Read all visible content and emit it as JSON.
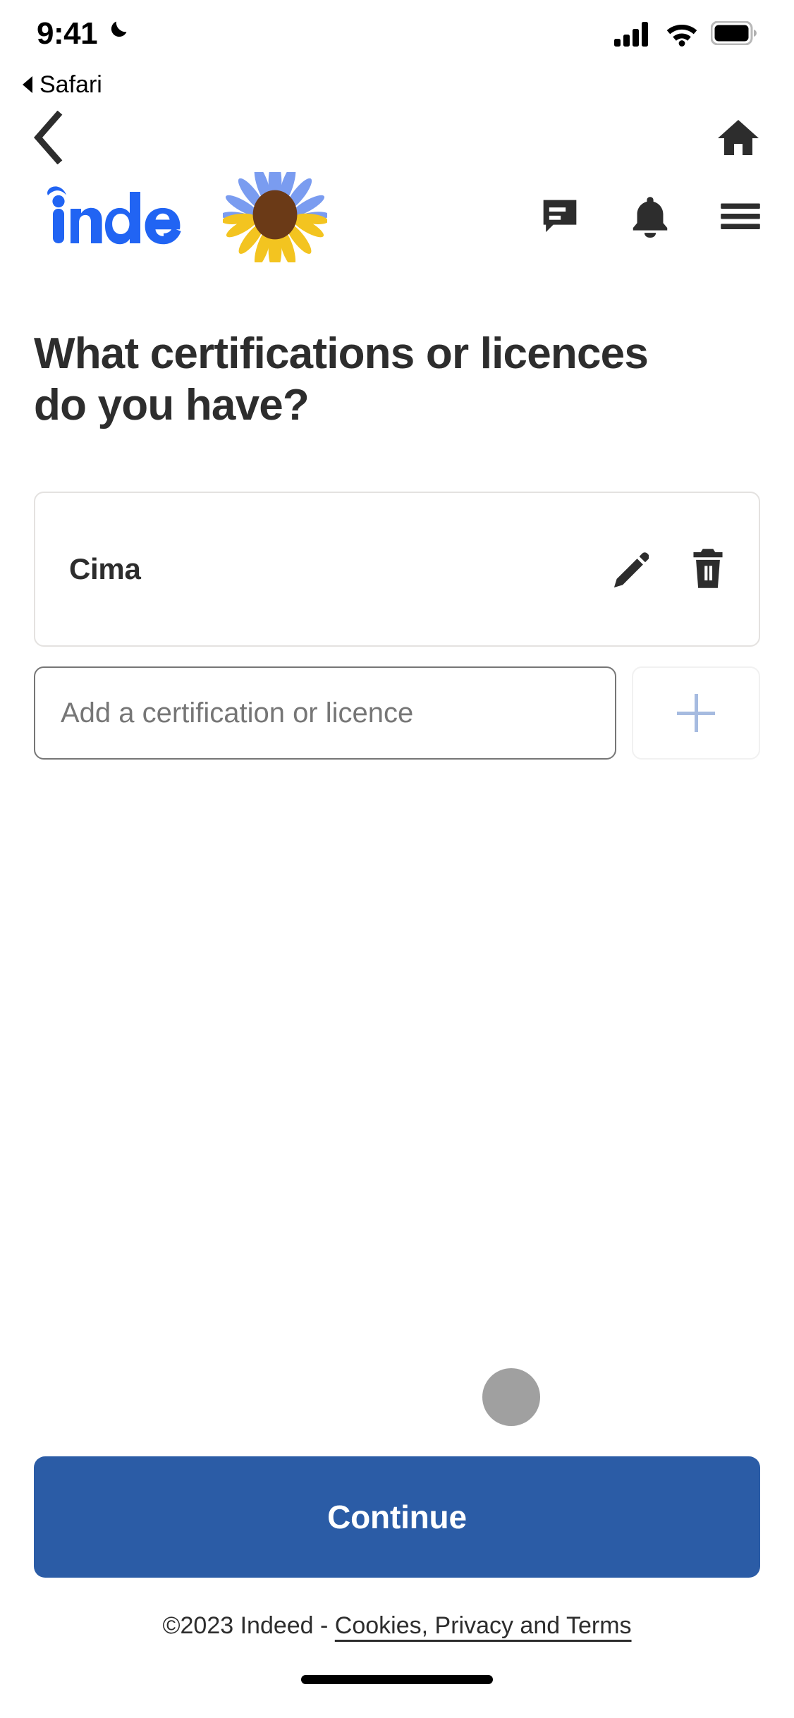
{
  "status_bar": {
    "time": "9:41",
    "moon_icon": "crescent-moon-icon",
    "signal_icon": "cellular-signal-icon",
    "wifi_icon": "wifi-icon",
    "battery_icon": "battery-full-icon"
  },
  "safari_return": {
    "back_arrow_icon": "triangle-left-icon",
    "label": "Safari"
  },
  "app_nav": {
    "back_icon": "chevron-left-icon",
    "home_icon": "home-icon"
  },
  "brand_header": {
    "logo_text": "indeed",
    "logo_color": "#2164f3",
    "sunflower_icon": "ukraine-sunflower-icon",
    "messages_icon": "message-bubble-icon",
    "notifications_icon": "bell-icon",
    "menu_icon": "hamburger-menu-icon"
  },
  "main": {
    "title": "What certifications or licences do you have?",
    "certifications": [
      {
        "name": "Cima",
        "edit_icon": "pencil-icon",
        "delete_icon": "trash-icon"
      }
    ],
    "add_field": {
      "value": "",
      "placeholder": "Add a certification or licence",
      "add_icon": "plus-icon",
      "add_icon_color": "#a6bbe0"
    }
  },
  "footer": {
    "continue_label": "Continue",
    "continue_color": "#2b5ca6",
    "legal_prefix": "©2023 Indeed - ",
    "legal_link": "Cookies, Privacy and Terms"
  }
}
